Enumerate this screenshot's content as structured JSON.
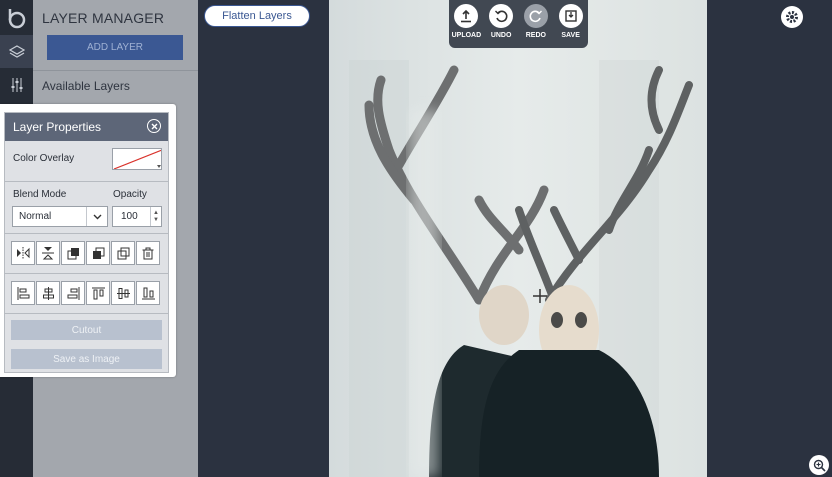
{
  "sidebar": {
    "panel_title": "LAYER MANAGER",
    "add_layer_label": "ADD LAYER",
    "available_layers_label": "Available Layers"
  },
  "canvas": {
    "flatten_label": "Flatten Layers"
  },
  "toolbar": {
    "upload_label": "UPLOAD",
    "undo_label": "UNDO",
    "redo_label": "REDO",
    "save_label": "SAVE"
  },
  "properties": {
    "title": "Layer Properties",
    "color_overlay_label": "Color Overlay",
    "blend_mode_label": "Blend Mode",
    "blend_mode_value": "Normal",
    "opacity_label": "Opacity",
    "opacity_value": "100",
    "cutout_label": "Cutout",
    "save_as_image_label": "Save as Image"
  },
  "colors": {
    "accent": "#3b5893",
    "panel_header": "#5d6678",
    "overlay_line": "#d9322b"
  }
}
